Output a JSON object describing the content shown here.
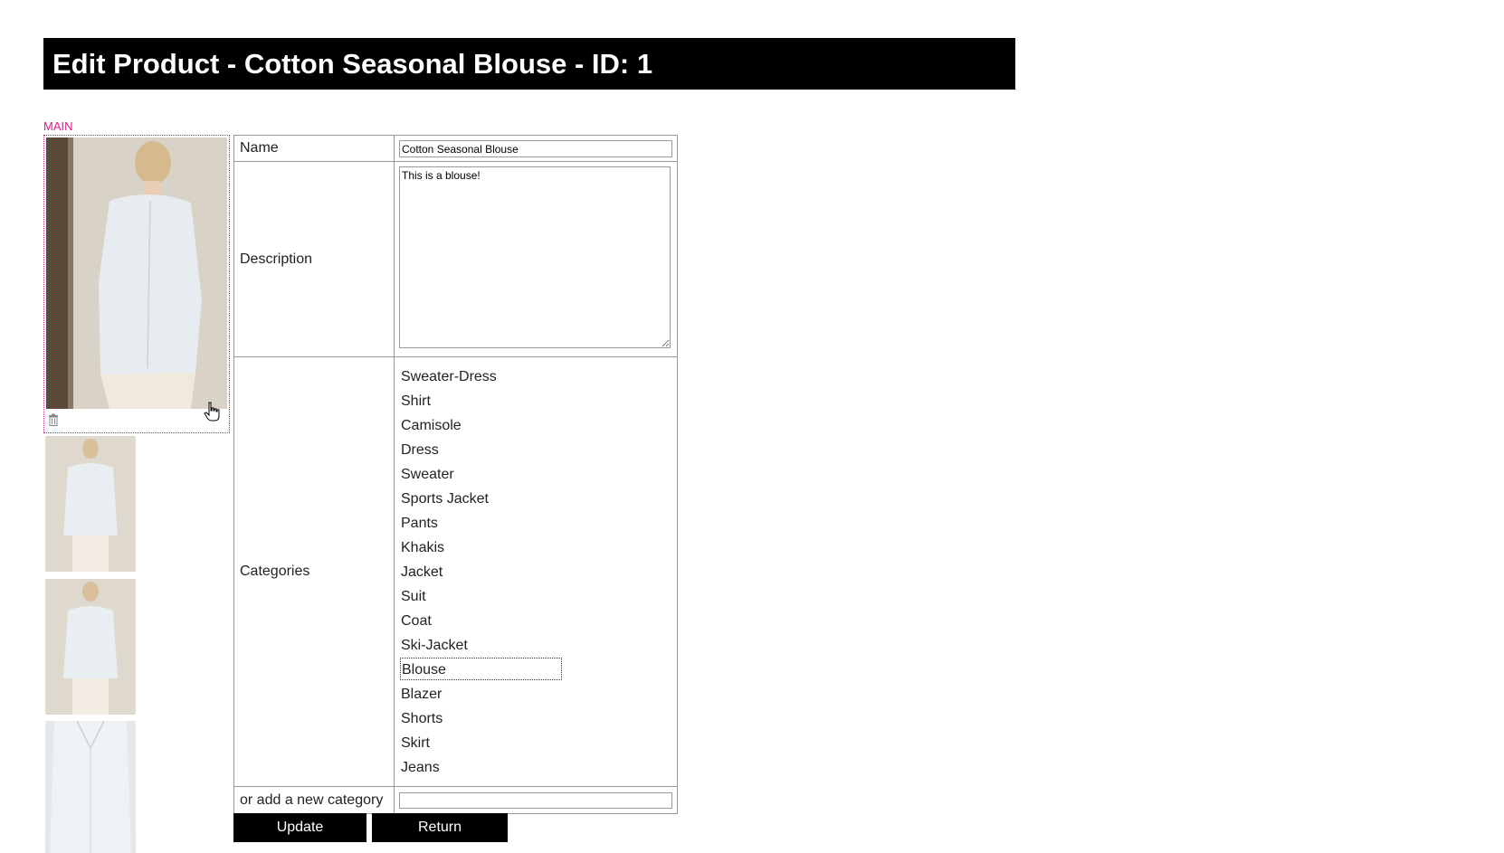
{
  "header": {
    "title": "Edit Product - Cotton Seasonal Blouse - ID: 1"
  },
  "images": {
    "main_label": "MAIN"
  },
  "form": {
    "name_label": "Name",
    "name_value": "Cotton Seasonal Blouse",
    "description_label": "Description",
    "description_value": "This is a blouse!",
    "categories_label": "Categories",
    "categories": [
      "Sweater-Dress",
      "Shirt",
      "Camisole",
      "Dress",
      "Sweater",
      "Sports Jacket",
      "Pants",
      "Khakis",
      "Jacket",
      "Suit",
      "Coat",
      "Ski-Jacket",
      "Blouse",
      "Blazer",
      "Shorts",
      "Skirt",
      "Jeans"
    ],
    "selected_category": "Blouse",
    "new_category_label": "or add a new category",
    "new_category_value": ""
  },
  "buttons": {
    "update": "Update",
    "return": "Return"
  },
  "colors": {
    "header_bg": "#000000",
    "main_accent": "#e0198c",
    "button_bg": "#000000"
  }
}
